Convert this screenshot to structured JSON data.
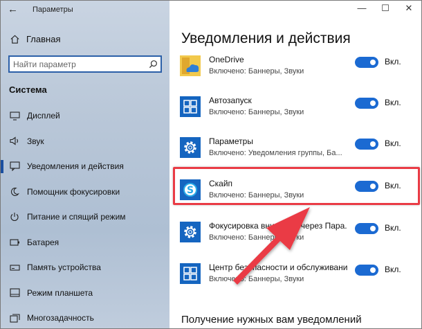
{
  "window": {
    "title": "Параметры"
  },
  "titlebar": {
    "back": "←",
    "minimize": "—",
    "maximize": "☐",
    "close": "✕"
  },
  "sidebar": {
    "home_label": "Главная",
    "search_placeholder": "Найти параметр",
    "section_title": "Система",
    "items": [
      {
        "label": "Дисплей",
        "icon": "display-icon",
        "active": false
      },
      {
        "label": "Звук",
        "icon": "speaker-icon",
        "active": false
      },
      {
        "label": "Уведомления и действия",
        "icon": "notifications-icon",
        "active": true
      },
      {
        "label": "Помощник фокусировки",
        "icon": "moon-icon",
        "active": false
      },
      {
        "label": "Питание и спящий режим",
        "icon": "power-icon",
        "active": false
      },
      {
        "label": "Батарея",
        "icon": "battery-icon",
        "active": false
      },
      {
        "label": "Память устройства",
        "icon": "storage-icon",
        "active": false
      },
      {
        "label": "Режим планшета",
        "icon": "tablet-icon",
        "active": false
      },
      {
        "label": "Многозадачность",
        "icon": "multitask-icon",
        "active": false
      }
    ]
  },
  "main": {
    "title": "Уведомления и действия",
    "apps": [
      {
        "name": "OneDrive",
        "status": "Включено: Баннеры, Звуки",
        "icon": "onedrive-icon",
        "toggle_on": true,
        "toggle_label": "Вкл."
      },
      {
        "name": "Автозапуск",
        "status": "Включено: Баннеры, Звуки",
        "icon": "autoplay-icon",
        "toggle_on": true,
        "toggle_label": "Вкл."
      },
      {
        "name": "Параметры",
        "status": "Включено: Уведомления группы, Ба...",
        "icon": "settings-gear-icon",
        "toggle_on": true,
        "toggle_label": "Вкл."
      },
      {
        "name": "Скайп",
        "status": "Включено: Баннеры, Звуки",
        "icon": "skype-icon",
        "toggle_on": true,
        "toggle_label": "Вкл."
      },
      {
        "name": "Фокусировка внимания через Пара...",
        "status": "Включено: Баннеры, Звуки",
        "icon": "settings-gear-icon",
        "toggle_on": true,
        "toggle_label": "Вкл."
      },
      {
        "name": "Центр безопасности и обслуживания",
        "status": "Включено: Баннеры, Звуки",
        "icon": "action-center-icon",
        "toggle_on": true,
        "toggle_label": "Вкл."
      }
    ],
    "section2_title": "Получение нужных вам уведомлений"
  },
  "colors": {
    "accent": "#1b6ad2",
    "highlight": "#ea3b45",
    "icon_bg": "#1565c0"
  }
}
